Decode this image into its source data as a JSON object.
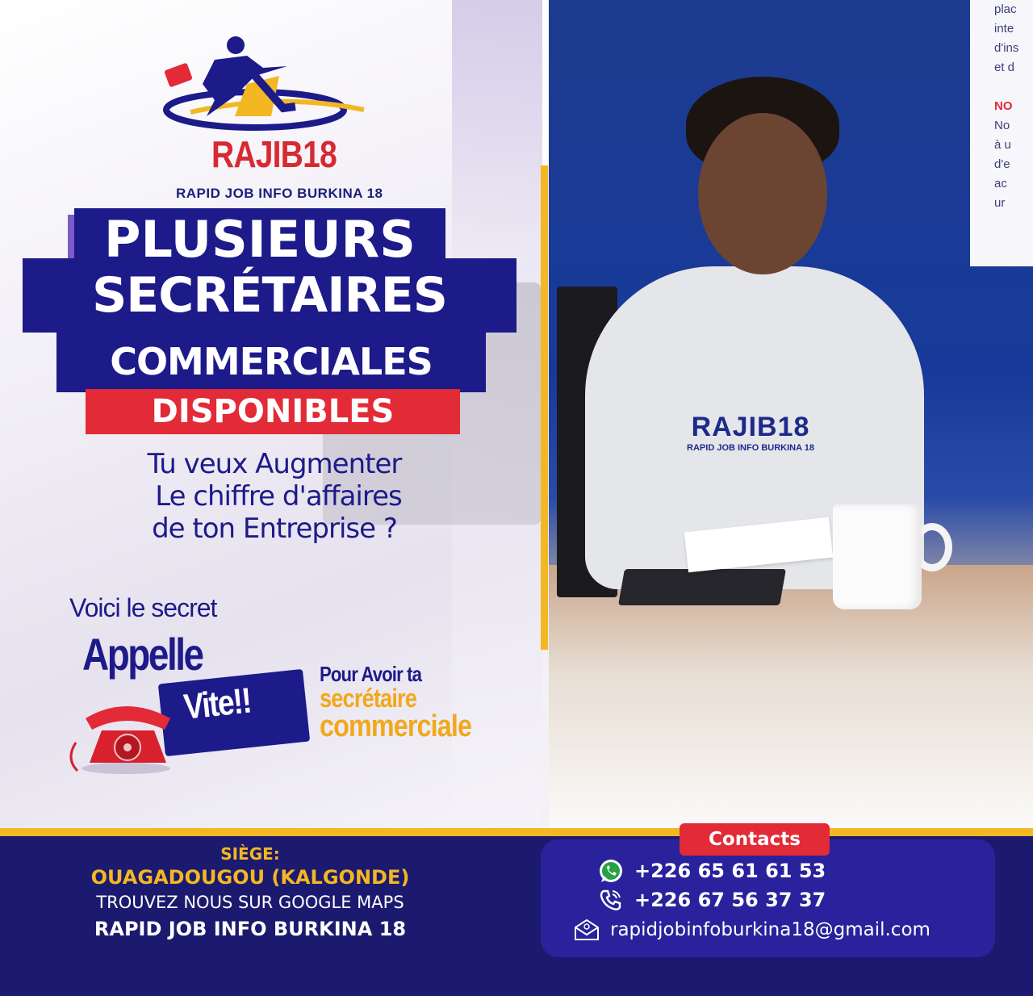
{
  "brand": {
    "name": "RAJIB18",
    "tagline": "RAPID JOB INFO BURKINA 18"
  },
  "headline": {
    "line1": "PLUSIEURS",
    "line2": "SECRÉTAIRES",
    "line3": "COMMERCIALES",
    "line4": "DISPONIBLES"
  },
  "question": {
    "line1": "Tu veux Augmenter",
    "line2": "Le chiffre d'affaires",
    "line3": "de ton Entreprise ?"
  },
  "cta": {
    "secret": "Voici le secret",
    "appelle": "Appelle",
    "vite": "Vite!!",
    "avoir": "Pour Avoir ta",
    "secretaire": "secrétaire",
    "commerciale": "commerciale"
  },
  "photo": {
    "shirt_brand": "RAJIB18",
    "shirt_tagline": "RAPID JOB INFO BURKINA 18",
    "poster_lines": [
      "plac",
      "inte",
      "d'ins",
      "et d",
      "",
      "NO",
      "No",
      "à u",
      "d'e",
      "ac",
      "ur"
    ]
  },
  "footer": {
    "siege_label": "SIÈGE:",
    "city": "OUAGADOUGOU (KALGONDE)",
    "maps": "TROUVEZ NOUS SUR GOOGLE MAPS",
    "company": "RAPID JOB INFO BURKINA 18",
    "contacts_label": "Contacts",
    "whatsapp": "+226 65 61 61 53",
    "phone": "+226 67 56 37 37",
    "email": "rapidjobinfoburkina18@gmail.com"
  },
  "colors": {
    "navy": "#1d1a8a",
    "red": "#e32a37",
    "yellow": "#f2b722",
    "footer": "#1c1a6e"
  },
  "icons": {
    "runner": "runner-logo-icon",
    "phone": "red-telephone-icon",
    "whatsapp": "whatsapp-icon",
    "call": "phone-call-icon",
    "email": "email-icon"
  }
}
